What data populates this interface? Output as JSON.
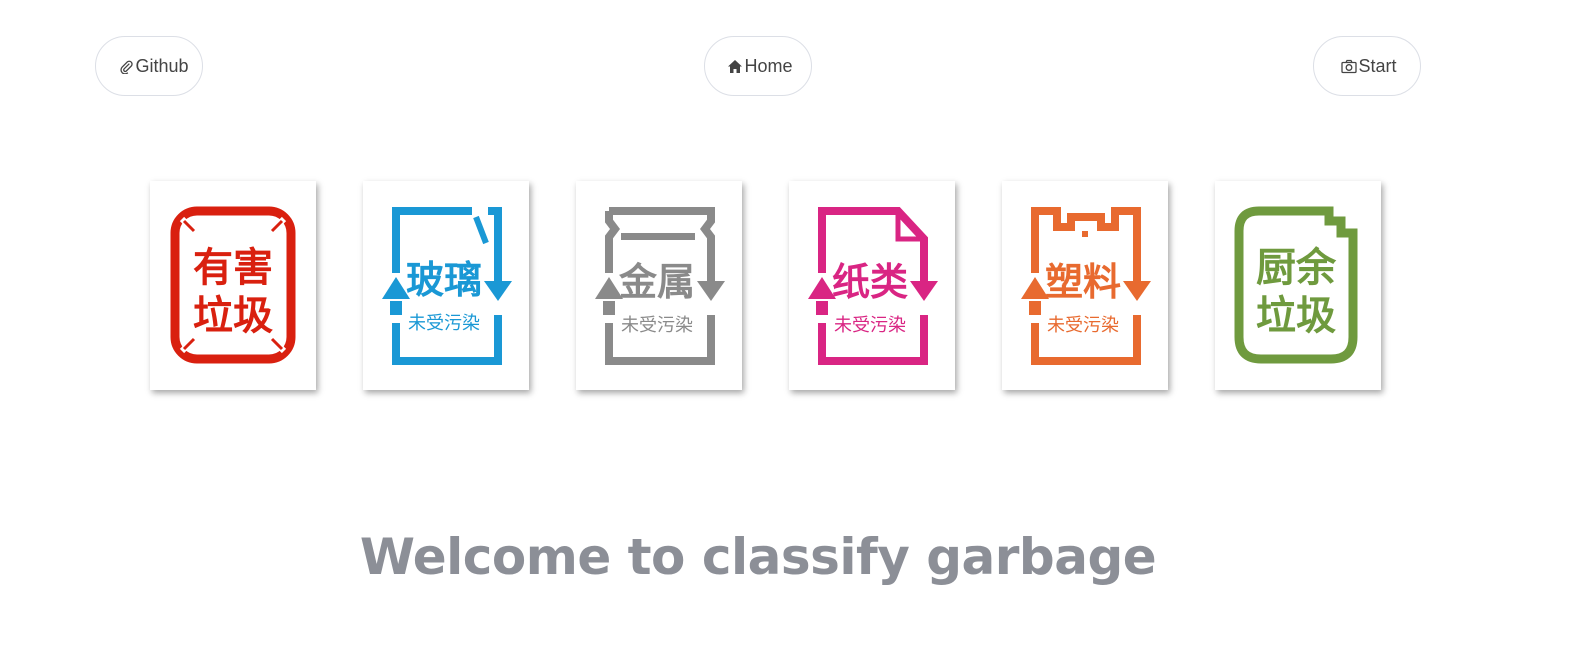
{
  "nav": {
    "github": {
      "label": "Github",
      "icon": "paperclip-icon"
    },
    "home": {
      "label": "Home",
      "icon": "home-icon"
    },
    "start": {
      "label": "Start",
      "icon": "camera-icon"
    }
  },
  "categories": [
    {
      "id": "hazardous",
      "line1": "有害",
      "line2": "垃圾",
      "sub": "",
      "color": "#d9200f",
      "icon": "hazardous-waste-icon"
    },
    {
      "id": "glass",
      "line1": "玻璃",
      "line2": "",
      "sub": "未受污染",
      "color": "#1a98d5",
      "icon": "glass-recycle-icon"
    },
    {
      "id": "metal",
      "line1": "金属",
      "line2": "",
      "sub": "未受污染",
      "color": "#8a8a8a",
      "icon": "metal-recycle-icon"
    },
    {
      "id": "paper",
      "line1": "纸类",
      "line2": "",
      "sub": "未受污染",
      "color": "#d92583",
      "icon": "paper-recycle-icon"
    },
    {
      "id": "plastic",
      "line1": "塑料",
      "line2": "",
      "sub": "未受污染",
      "color": "#e86a2f",
      "icon": "plastic-recycle-icon"
    },
    {
      "id": "kitchen",
      "line1": "厨余",
      "line2": "垃圾",
      "sub": "",
      "color": "#6f9a3e",
      "icon": "kitchen-waste-icon"
    }
  ],
  "welcome": "Welcome to classify garbage"
}
